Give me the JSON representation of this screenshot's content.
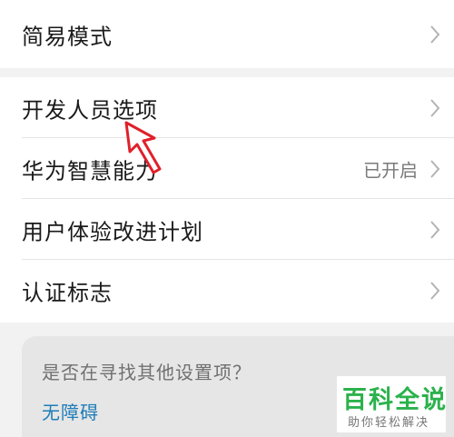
{
  "top_group": {
    "rows": [
      {
        "label": "简易模式",
        "value": ""
      }
    ]
  },
  "main_group": {
    "rows": [
      {
        "label": "开发人员选项",
        "value": ""
      },
      {
        "label": "华为智慧能力",
        "value": "已开启"
      },
      {
        "label": "用户体验改进计划",
        "value": ""
      },
      {
        "label": "认证标志",
        "value": ""
      }
    ]
  },
  "search_card": {
    "question": "是否在寻找其他设置项？",
    "link": "无障碍"
  },
  "watermark": {
    "title": "百科全说",
    "subtitle": "助你轻松解决"
  },
  "colors": {
    "background": "#f2f2f2",
    "card": "#ffffff",
    "link": "#1f7db8",
    "annotation_arrow": "#e0202a",
    "watermark_green": "#2bb24c"
  },
  "icons": {
    "row_chevron": "chevron-right-icon",
    "annotation": "cursor-arrow-icon"
  }
}
